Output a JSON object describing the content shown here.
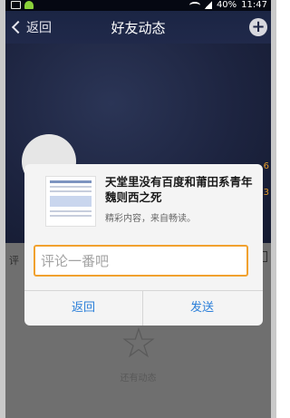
{
  "status_bar": {
    "battery": "40%",
    "time": "11:47"
  },
  "header": {
    "back_label": "返回",
    "title": "好友动态",
    "add_label": "+"
  },
  "background": {
    "side_numbers": [
      "6",
      "3"
    ],
    "row_text": "评",
    "empty_text": "还有动态"
  },
  "dialog": {
    "share_title": "天堂里没有百度和莆田系青年魏则西之死",
    "share_desc": "精彩内容，来自畅读。",
    "comment_placeholder": "评论一番吧",
    "comment_value": "",
    "cancel_label": "返回",
    "send_label": "发送"
  },
  "colors": {
    "accent_orange": "#f1a12e",
    "button_blue": "#2b7fd9",
    "header_bg": "#1b2544"
  }
}
